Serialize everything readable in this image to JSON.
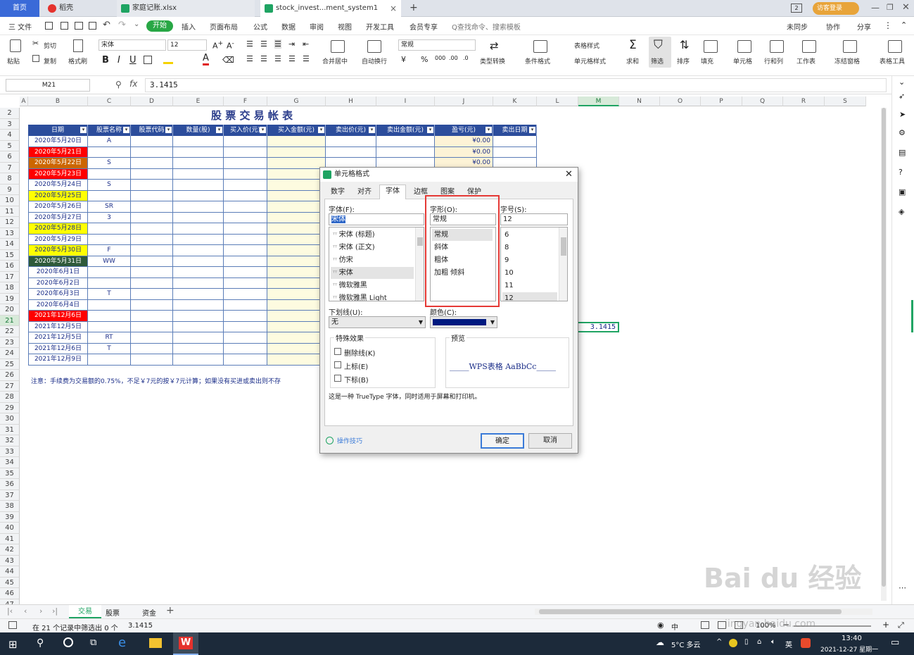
{
  "tabs": {
    "home": "首页",
    "daoke": "稻壳",
    "file1": "家庭记账.xlsx",
    "file2": "stock_invest...ment_system1",
    "add": "+",
    "visitor": "访客登录"
  },
  "menu": {
    "file": "三 文件",
    "start": "开始",
    "items": [
      "插入",
      "页面布局",
      "公式",
      "数据",
      "审阅",
      "视图",
      "开发工具",
      "会员专享"
    ],
    "search": "Q查找命令、搜索模板",
    "sync": "未同步",
    "collab": "协作",
    "share": "分享"
  },
  "ribbon": {
    "paste": "粘贴",
    "cut": "剪切",
    "copy": "复制",
    "format_painter": "格式刷",
    "font_name": "宋体",
    "font_size": "12",
    "num_format": "常规",
    "merge": "合并居中",
    "wrap": "自动换行",
    "convert": "类型转换",
    "cond_format": "条件格式",
    "table_style": "表格样式",
    "cell_style": "单元格样式",
    "sum": "求和",
    "filter": "筛选",
    "sort": "排序",
    "fill": "填充",
    "cell": "单元格",
    "rowcol": "行和列",
    "sheet": "工作表",
    "freeze": "冻结窗格",
    "tools": "表格工具"
  },
  "formula": {
    "cell_ref": "M21",
    "fx": "fx",
    "value": "3.1415"
  },
  "sheet": {
    "title": "股 票 交 易 帐 表",
    "columns": [
      "A",
      "B",
      "C",
      "D",
      "E",
      "F",
      "G",
      "H",
      "I",
      "J",
      "K",
      "L",
      "M",
      "N",
      "O",
      "P",
      "Q",
      "R",
      "S"
    ],
    "rows": [
      "2",
      "3",
      "4",
      "5",
      "6",
      "7",
      "8",
      "9",
      "10",
      "11",
      "12",
      "13",
      "14",
      "15",
      "16",
      "17",
      "18",
      "19",
      "20",
      "21",
      "22",
      "23",
      "24",
      "25",
      "26",
      "27",
      "28",
      "29",
      "30",
      "31",
      "32",
      "33",
      "34",
      "35",
      "36",
      "37",
      "38",
      "39",
      "40",
      "41",
      "42",
      "43",
      "44",
      "45",
      "46",
      "47"
    ],
    "headers": [
      "日期",
      "股票名称",
      "股票代码",
      "数量(股)",
      "买入价(元)",
      "买入金额(元)",
      "卖出价(元)",
      "卖出金额(元)",
      "盈亏(元)",
      "卖出日期"
    ],
    "dates": [
      "2020年5月20日",
      "2020年5月21日",
      "2020年5月22日",
      "2020年5月23日",
      "2020年5月24日",
      "2020年5月25日",
      "2020年5月26日",
      "2020年5月27日",
      "2020年5月28日",
      "2020年5月29日",
      "2020年5月30日",
      "2020年5月31日",
      "2020年6月1日",
      "2020年6月2日",
      "2020年6月3日",
      "2020年6月4日",
      "2021年12月6日",
      "2021年12月5日",
      "2021年12月5日",
      "2021年12月6日",
      "2021年12月9日"
    ],
    "date_colors": [
      "#ffffff",
      "#ff0000",
      "#cc6600",
      "#ff0000",
      "#ffffff",
      "#ffff00",
      "#ffffff",
      "#ffffff",
      "#ffff00",
      "#ffffff",
      "#ffff00",
      "#2e5a3a",
      "#ffffff",
      "#ffffff",
      "#ffffff",
      "#ffffff",
      "#ff0000",
      "#ffffff",
      "#ffffff",
      "#ffffff",
      "#ffffff"
    ],
    "names": [
      "A",
      "",
      "S",
      "",
      "S",
      "",
      "SR",
      "3",
      "",
      "",
      "F",
      "WW",
      "",
      "",
      "T",
      "",
      "",
      "",
      "RT",
      "T",
      ""
    ],
    "profits": [
      "¥0.00",
      "¥0.00",
      "¥0.00"
    ],
    "note": "注意：手续费为交易额的0.75%，不足￥7元的按￥7元计算；如果没有买进或卖出则不存",
    "m21": "3.1415"
  },
  "dialog": {
    "title": "单元格格式",
    "tabs": [
      "数字",
      "对齐",
      "字体",
      "边框",
      "图案",
      "保护"
    ],
    "font_label": "字体(F):",
    "font_value": "宋体",
    "fonts": [
      "宋体 (标题)",
      "宋体 (正文)",
      "仿宋",
      "宋体",
      "微软雅黑",
      "微软雅黑 Light"
    ],
    "style_label": "字形(O):",
    "style_value": "常规",
    "styles": [
      "常规",
      "斜体",
      "粗体",
      "加粗 倾斜"
    ],
    "size_label": "字号(S):",
    "size_value": "12",
    "sizes": [
      "6",
      "8",
      "9",
      "10",
      "11",
      "12"
    ],
    "underline_label": "下划线(U):",
    "underline_value": "无",
    "color_label": "颜色(C):",
    "effects_label": "特殊效果",
    "strike": "删除线(K)",
    "superscript": "上标(E)",
    "subscript": "下标(B)",
    "preview_label": "预览",
    "preview_text": "_____WPS表格  AaBbCc_____",
    "desc": "这是一种 TrueType 字体，同时适用于屏幕和打印机。",
    "tips": "操作技巧",
    "ok": "确定",
    "cancel": "取消",
    "color_value": "#001a80"
  },
  "sheettabs": [
    "交易",
    "股票",
    "资金"
  ],
  "status": {
    "filter_info": "在 21 个记录中筛选出 0 个",
    "value": "3.1415",
    "zoom": "100%"
  },
  "taskbar": {
    "weather": "5°C 多云",
    "lang": "英",
    "time": "13:40",
    "date": "2021-12-27 星期一"
  },
  "watermark": "Bai du 经验",
  "watermark_url": "jingyan.baidu.com"
}
